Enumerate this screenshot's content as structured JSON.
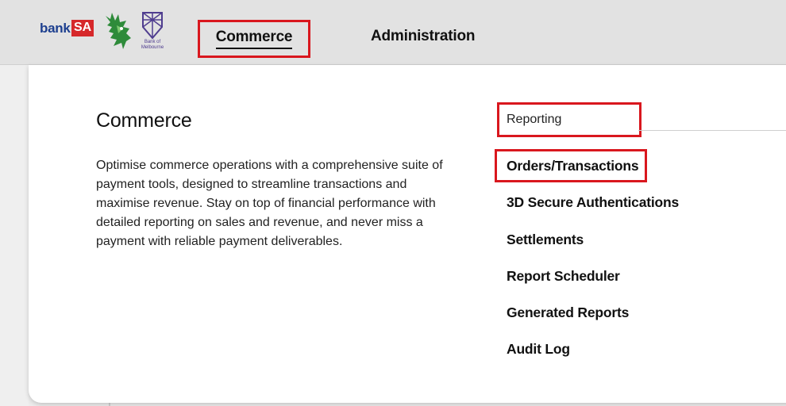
{
  "brands": {
    "banksa_word": "bank",
    "banksa_badge": "SA",
    "bank_of_melbourne": "Bank of Melbourne"
  },
  "nav": {
    "commerce": "Commerce",
    "administration": "Administration"
  },
  "panel": {
    "title": "Commerce",
    "description": "Optimise commerce operations with a comprehensive suite of payment tools, designed to streamline transactions and maximise revenue. Stay on top of financial performance with detailed reporting on sales and revenue, and never miss a payment with reliable payment deliverables."
  },
  "reporting": {
    "section_label": "Reporting",
    "links": [
      "Orders/Transactions",
      "3D Secure Authentications",
      "Settlements",
      "Report Scheduler",
      "Generated Reports",
      "Audit Log"
    ]
  },
  "colors": {
    "highlight": "#d9171e",
    "brand_blue": "#1d3f8f",
    "brand_red": "#d6282a",
    "dragon_green": "#2e8b3a",
    "bom_purple": "#4f3d8f"
  }
}
